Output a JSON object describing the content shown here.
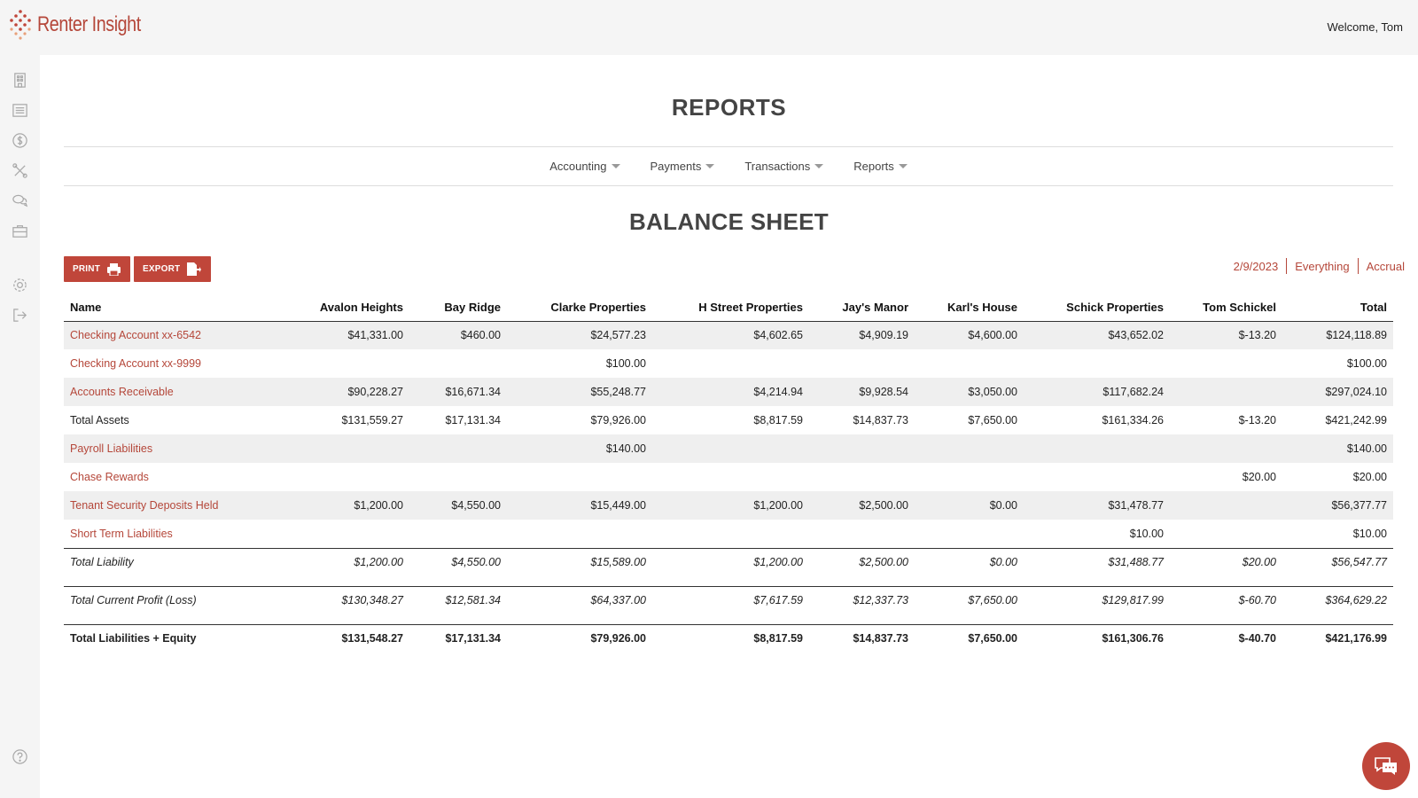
{
  "header": {
    "app_name": "Renter Insight",
    "welcome": "Welcome, Tom"
  },
  "sidebar": {
    "icons": [
      "buildings-icon",
      "list-icon",
      "dollar-icon",
      "tools-icon",
      "chat-icon",
      "briefcase-icon",
      "gear-icon",
      "logout-icon",
      "help-icon"
    ]
  },
  "page": {
    "title": "REPORTS",
    "nav": [
      {
        "label": "Accounting"
      },
      {
        "label": "Payments"
      },
      {
        "label": "Transactions"
      },
      {
        "label": "Reports"
      }
    ],
    "report_title": "BALANCE SHEET",
    "print_label": "PRINT",
    "export_label": "EXPORT",
    "filters": {
      "date": "2/9/2023",
      "scope": "Everything",
      "basis": "Accrual"
    }
  },
  "colors": {
    "accent": "#c0463a",
    "link": "#b5473a"
  },
  "table": {
    "headers": [
      "Name",
      "Avalon Heights",
      "Bay Ridge",
      "Clarke Properties",
      "H Street Properties",
      "Jay's Manor",
      "Karl's House",
      "Schick Properties",
      "Tom Schickel",
      "Total"
    ],
    "rows": [
      [
        "Checking Account xx-6542",
        "$41,331.00",
        "$460.00",
        "$24,577.23",
        "$4,602.65",
        "$4,909.19",
        "$4,600.00",
        "$43,652.02",
        "$-13.20",
        "$124,118.89"
      ],
      [
        "Checking Account xx-9999",
        "",
        "",
        "$100.00",
        "",
        "",
        "",
        "",
        "",
        "$100.00"
      ],
      [
        "Accounts Receivable",
        "$90,228.27",
        "$16,671.34",
        "$55,248.77",
        "$4,214.94",
        "$9,928.54",
        "$3,050.00",
        "$117,682.24",
        "",
        "$297,024.10"
      ],
      [
        "Total Assets",
        "$131,559.27",
        "$17,131.34",
        "$79,926.00",
        "$8,817.59",
        "$14,837.73",
        "$7,650.00",
        "$161,334.26",
        "$-13.20",
        "$421,242.99"
      ],
      [
        "Payroll Liabilities",
        "",
        "",
        "$140.00",
        "",
        "",
        "",
        "",
        "",
        "$140.00"
      ],
      [
        "Chase Rewards",
        "",
        "",
        "",
        "",
        "",
        "",
        "",
        "$20.00",
        "$20.00"
      ],
      [
        "Tenant Security Deposits Held",
        "$1,200.00",
        "$4,550.00",
        "$15,449.00",
        "$1,200.00",
        "$2,500.00",
        "$0.00",
        "$31,478.77",
        "",
        "$56,377.77"
      ],
      [
        "Short Term Liabilities",
        "",
        "",
        "",
        "",
        "",
        "",
        "$10.00",
        "",
        "$10.00"
      ],
      [
        "Total Liability",
        "$1,200.00",
        "$4,550.00",
        "$15,589.00",
        "$1,200.00",
        "$2,500.00",
        "$0.00",
        "$31,488.77",
        "$20.00",
        "$56,547.77"
      ],
      [
        "Total Current Profit (Loss)",
        "$130,348.27",
        "$12,581.34",
        "$64,337.00",
        "$7,617.59",
        "$12,337.73",
        "$7,650.00",
        "$129,817.99",
        "$-60.70",
        "$364,629.22"
      ],
      [
        "Total Liabilities + Equity",
        "$131,548.27",
        "$17,131.34",
        "$79,926.00",
        "$8,817.59",
        "$14,837.73",
        "$7,650.00",
        "$161,306.76",
        "$-40.70",
        "$421,176.99"
      ]
    ]
  }
}
